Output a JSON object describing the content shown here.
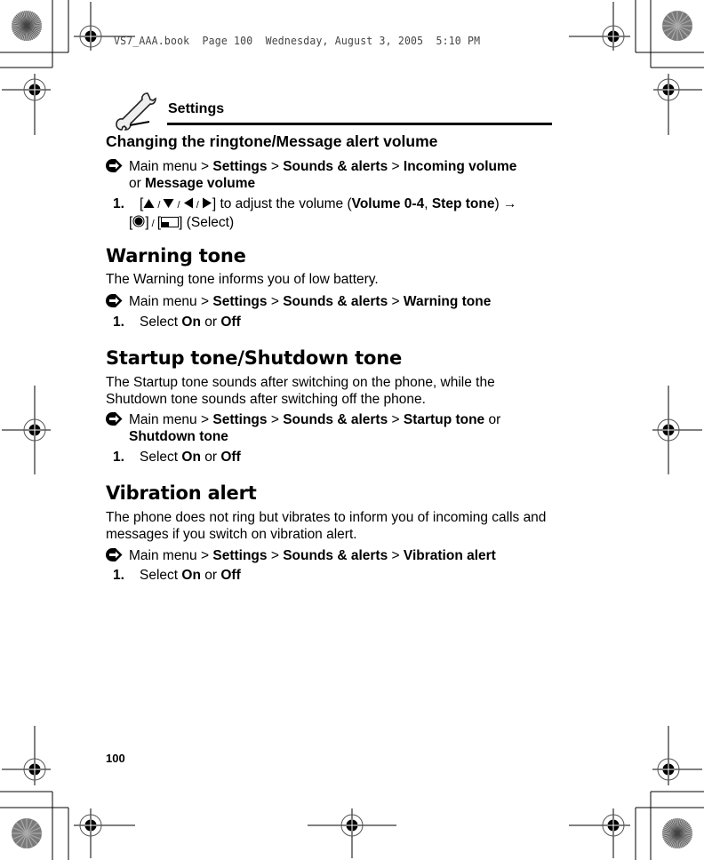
{
  "slug": "VS7_AAA.book  Page 100  Wednesday, August 3, 2005  5:10 PM",
  "header": {
    "icon": "wrench-icon",
    "title": "Settings"
  },
  "sections": [
    {
      "heading": "Changing the ringtone/Message alert volume",
      "nav": {
        "prefix": "Main menu",
        "sep": ">",
        "path": [
          "Settings",
          "Sounds & alerts",
          "Incoming volume"
        ],
        "or": "or",
        "alt": "Message volume"
      },
      "step": {
        "num": "1.",
        "keys": [
          "up-key-icon",
          "down-key-icon",
          "left-key-icon",
          "right-key-icon"
        ],
        "text_before": "to adjust the volume (",
        "bold1": "Volume 0-4",
        "comma": ", ",
        "bold2": "Step tone",
        "text_after": ")",
        "arrow": "→",
        "line2_keys": [
          "center-key-icon",
          "soft-key-icon"
        ],
        "line2_text": "(Select)"
      }
    },
    {
      "heading": "Warning tone",
      "desc": "The Warning tone informs you of low battery.",
      "nav": {
        "prefix": "Main menu",
        "sep": ">",
        "path": [
          "Settings",
          "Sounds & alerts",
          "Warning tone"
        ]
      },
      "step": {
        "num": "1.",
        "select": "Select",
        "on": "On",
        "or": "or",
        "off": "Off"
      }
    },
    {
      "heading": "Startup tone/Shutdown tone",
      "desc": "The Startup tone sounds after switching on the phone, while the Shutdown tone sounds after switching off the phone.",
      "nav": {
        "prefix": "Main menu",
        "sep": ">",
        "path": [
          "Settings",
          "Sounds & alerts",
          "Startup tone"
        ],
        "or": "or",
        "alt": "Shutdown tone"
      },
      "step": {
        "num": "1.",
        "select": "Select",
        "on": "On",
        "or": "or",
        "off": "Off"
      }
    },
    {
      "heading": "Vibration alert",
      "desc": "The phone does not ring but vibrates to inform you of incoming calls and messages if you switch on vibration alert.",
      "nav": {
        "prefix": "Main menu",
        "sep": ">",
        "path": [
          "Settings",
          "Sounds & alerts",
          "Vibration alert"
        ]
      },
      "step": {
        "num": "1.",
        "select": "Select",
        "on": "On",
        "or": "or",
        "off": "Off"
      }
    }
  ],
  "page_number": "100"
}
